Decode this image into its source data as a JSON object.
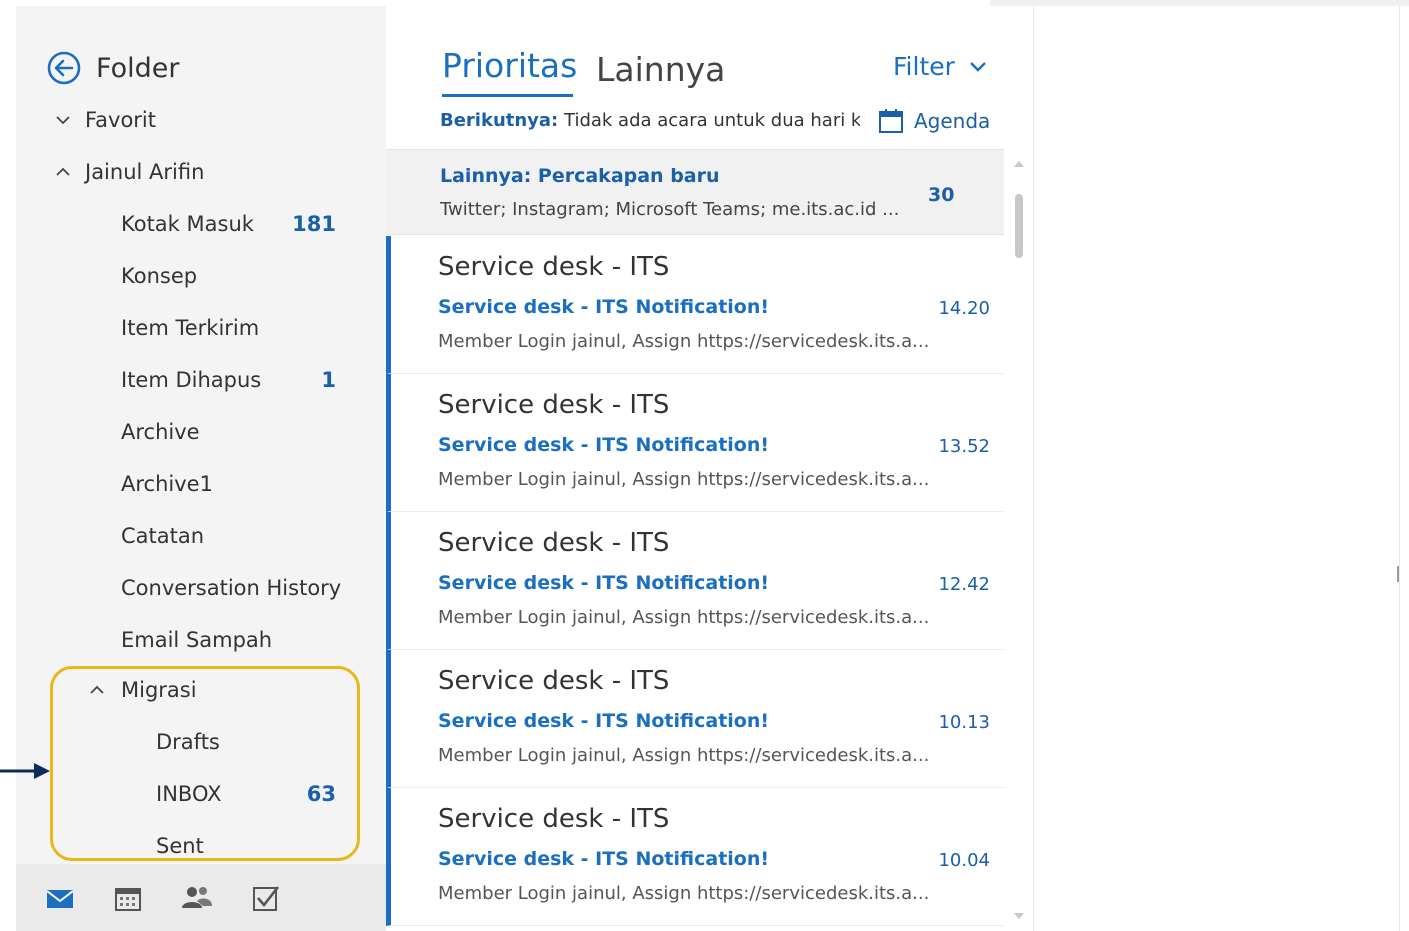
{
  "folders": {
    "header_label": "Folder",
    "favorites_label": "Favorit",
    "account_label": "Jainul Arifin",
    "items": [
      {
        "label": "Kotak Masuk",
        "count": "181"
      },
      {
        "label": "Konsep",
        "count": ""
      },
      {
        "label": "Item Terkirim",
        "count": ""
      },
      {
        "label": "Item Dihapus",
        "count": "1"
      },
      {
        "label": "Archive",
        "count": ""
      },
      {
        "label": "Archive1",
        "count": ""
      },
      {
        "label": "Catatan",
        "count": ""
      },
      {
        "label": "Conversation History",
        "count": ""
      },
      {
        "label": "Email Sampah",
        "count": ""
      }
    ],
    "migrasi": {
      "label": "Migrasi",
      "children": [
        {
          "label": "Drafts",
          "count": ""
        },
        {
          "label": "INBOX",
          "count": "63"
        },
        {
          "label": "Sent",
          "count": ""
        }
      ]
    }
  },
  "bottom_nav": [
    "mail-icon",
    "calendar-icon",
    "people-icon",
    "tasks-icon"
  ],
  "list": {
    "tab_focused": "Prioritas",
    "tab_other": "Lainnya",
    "filter_label": "Filter",
    "agenda_prefix": "Berikutnya:",
    "agenda_text": "Tidak ada acara untuk dua hari ke",
    "agenda_link": "Agenda",
    "other_notice": {
      "title": "Lainnya: Percakapan baru",
      "senders": "Twitter; Instagram; Microsoft Teams; me.its.ac.id ...",
      "count": "30"
    },
    "messages": [
      {
        "sender": "Service desk - ITS",
        "subject": "Service desk - ITS Notification!",
        "time": "14.20",
        "preview": "Member Login jainul,  Assign https://servicedesk.its.a..."
      },
      {
        "sender": "Service desk - ITS",
        "subject": "Service desk - ITS Notification!",
        "time": "13.52",
        "preview": "Member Login jainul,  Assign https://servicedesk.its.a..."
      },
      {
        "sender": "Service desk - ITS",
        "subject": "Service desk - ITS Notification!",
        "time": "12.42",
        "preview": "Member Login jainul,  Assign https://servicedesk.its.a..."
      },
      {
        "sender": "Service desk - ITS",
        "subject": "Service desk - ITS Notification!",
        "time": "10.13",
        "preview": "Member Login jainul,  Assign https://servicedesk.its.a..."
      },
      {
        "sender": "Service desk - ITS",
        "subject": "Service desk - ITS Notification!",
        "time": "10.04",
        "preview": "Member Login jainul,  Assign https://servicedesk.its.a..."
      }
    ]
  },
  "colors": {
    "accent": "#1a6fc1",
    "highlight_box": "#e8b818",
    "arrow": "#0d2a5c",
    "folder_pane_bg": "#f4f4f4"
  }
}
